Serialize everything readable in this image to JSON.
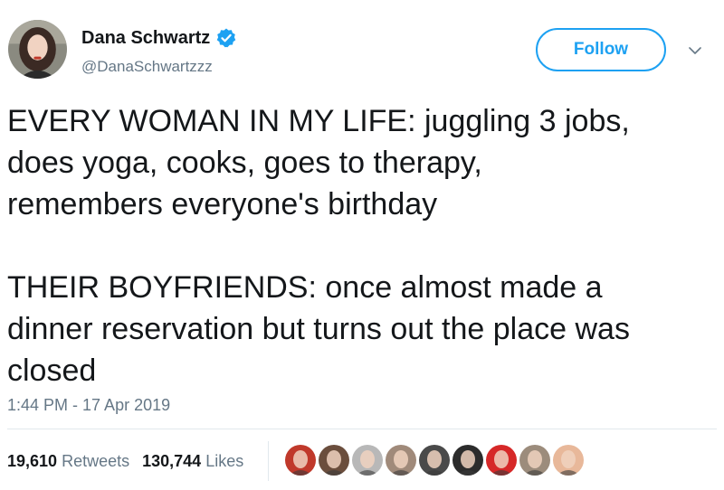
{
  "author": {
    "name": "Dana Schwartz",
    "handle": "@DanaSchwartzzz",
    "verified": true
  },
  "follow_label": "Follow",
  "text": "EVERY WOMAN IN MY LIFE: juggling 3 jobs,\ndoes yoga, cooks, goes to therapy,\nremembers everyone's birthday\n\nTHEIR BOYFRIENDS: once almost made a\ndinner reservation but turns out the place was\nclosed",
  "timestamp": "1:44 PM - 17 Apr 2019",
  "stats": {
    "retweets_count": "19,610",
    "retweets_label": "Retweets",
    "likes_count": "130,744",
    "likes_label": "Likes"
  },
  "colors": {
    "accent": "#1da1f2",
    "secondary_text": "#657786",
    "primary_text": "#14171a",
    "divider": "#e1e8ed"
  },
  "liker_avatar_colors": [
    "#c0392b",
    "#6b4e3d",
    "#b8b8b8",
    "#a08a7a",
    "#4a4a4a",
    "#2c2c2c",
    "#d62828",
    "#9c8c7c",
    "#e8b89a"
  ]
}
